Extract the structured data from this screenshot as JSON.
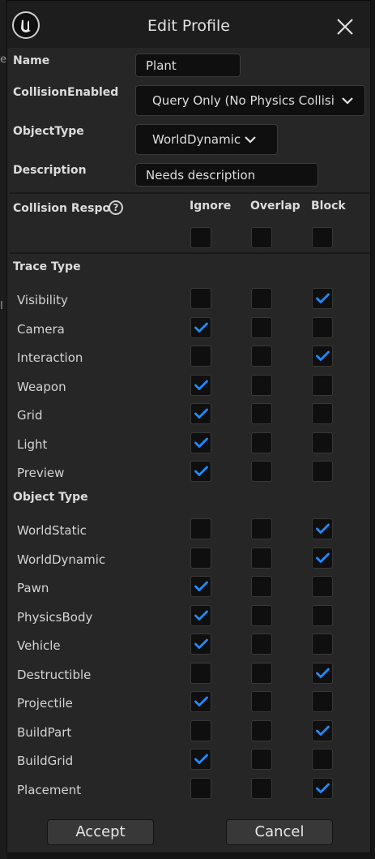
{
  "background_fragments": [
    "el",
    "I"
  ],
  "window": {
    "title": "Edit Profile",
    "name_label": "Name",
    "name_value": "Plant",
    "collision_enabled_label": "CollisionEnabled",
    "collision_enabled_value": "Query Only (No Physics Collisi",
    "object_type_label": "ObjectType",
    "object_type_value": "WorldDynamic",
    "description_label": "Description",
    "description_value": "Needs description"
  },
  "responses": {
    "header_label": "Collision Respo",
    "help_glyph": "?",
    "columns": [
      "Ignore",
      "Overlap",
      "Block"
    ],
    "trace_section": "Trace Type",
    "object_section": "Object Type",
    "trace_rows": [
      {
        "label": "Visibility",
        "response": "Block"
      },
      {
        "label": "Camera",
        "response": "Ignore"
      },
      {
        "label": "Interaction",
        "response": "Block"
      },
      {
        "label": "Weapon",
        "response": "Ignore"
      },
      {
        "label": "Grid",
        "response": "Ignore"
      },
      {
        "label": "Light",
        "response": "Ignore"
      },
      {
        "label": "Preview",
        "response": "Ignore"
      }
    ],
    "object_rows": [
      {
        "label": "WorldStatic",
        "response": "Block"
      },
      {
        "label": "WorldDynamic",
        "response": "Block"
      },
      {
        "label": "Pawn",
        "response": "Ignore"
      },
      {
        "label": "PhysicsBody",
        "response": "Ignore"
      },
      {
        "label": "Vehicle",
        "response": "Ignore"
      },
      {
        "label": "Destructible",
        "response": "Block"
      },
      {
        "label": "Projectile",
        "response": "Ignore"
      },
      {
        "label": "BuildPart",
        "response": "Block"
      },
      {
        "label": "BuildGrid",
        "response": "Ignore"
      },
      {
        "label": "Placement",
        "response": "Block"
      }
    ]
  },
  "buttons": {
    "accept": "Accept",
    "cancel": "Cancel"
  },
  "icons": {
    "logo": "unreal-logo-icon",
    "close": "close-icon",
    "help": "help-icon",
    "dropdown": "chevron-down-icon",
    "check": "checkmark-icon"
  },
  "colors": {
    "check": "#1e8bff",
    "panel": "#262626",
    "field": "#0f0f0f"
  }
}
